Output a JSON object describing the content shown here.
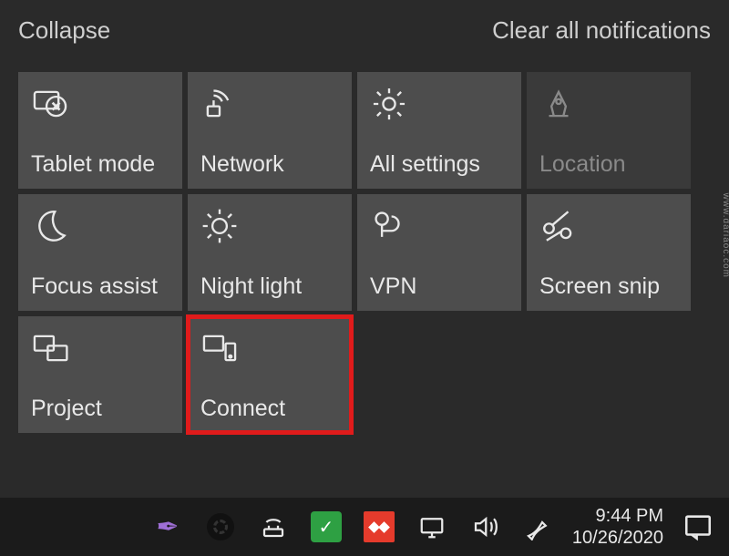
{
  "header": {
    "collapse_label": "Collapse",
    "clear_label": "Clear all notifications"
  },
  "tiles": [
    {
      "label": "Tablet mode",
      "icon": "tablet-icon",
      "disabled": false,
      "highlight": false
    },
    {
      "label": "Network",
      "icon": "network-icon",
      "disabled": false,
      "highlight": false
    },
    {
      "label": "All settings",
      "icon": "settings-icon",
      "disabled": false,
      "highlight": false
    },
    {
      "label": "Location",
      "icon": "location-icon",
      "disabled": true,
      "highlight": false
    },
    {
      "label": "Focus assist",
      "icon": "moon-icon",
      "disabled": false,
      "highlight": false
    },
    {
      "label": "Night light",
      "icon": "sun-icon",
      "disabled": false,
      "highlight": false
    },
    {
      "label": "VPN",
      "icon": "vpn-icon",
      "disabled": false,
      "highlight": false
    },
    {
      "label": "Screen snip",
      "icon": "snip-icon",
      "disabled": false,
      "highlight": false
    },
    {
      "label": "Project",
      "icon": "project-icon",
      "disabled": false,
      "highlight": false
    },
    {
      "label": "Connect",
      "icon": "connect-icon",
      "disabled": false,
      "highlight": true
    }
  ],
  "taskbar": {
    "clock_time": "9:44 PM",
    "clock_date": "10/26/2020"
  },
  "watermark": "www.dariaoc.com"
}
